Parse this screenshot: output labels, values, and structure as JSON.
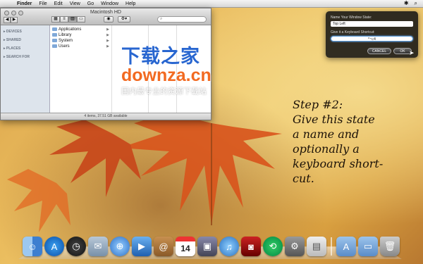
{
  "menubar": {
    "apple": "",
    "items": [
      "Finder",
      "File",
      "Edit",
      "View",
      "Go",
      "Window",
      "Help"
    ],
    "right_icons": [
      "bluetooth-star-icon",
      "spotlight-icon"
    ]
  },
  "finder": {
    "title": "Macintosh HD",
    "search_placeholder": "",
    "sidebar_sections": [
      "DEVICES",
      "SHARED",
      "PLACES",
      "SEARCH FOR"
    ],
    "column_items": [
      "Applications",
      "Library",
      "System",
      "Users"
    ],
    "status": "4 items, 37.51 GB available"
  },
  "dialog": {
    "name_label": "Name Your Window State:",
    "name_value": "Top Left",
    "shortcut_label": "Give it a Keyboard Shortcut:",
    "shortcut_value": "^⌥4",
    "cancel": "CANCEL",
    "ok": "OK"
  },
  "watermark": {
    "cn": "下载之家",
    "en": "downza.cn",
    "sub": "国内最专业的资源下载站"
  },
  "step_text": [
    "Step #2:",
    "Give this state",
    "a name and",
    "optionally a",
    "keyboard short-",
    "cut."
  ],
  "dock": {
    "icons": [
      "finder-icon",
      "app-store-icon",
      "dashboard-icon",
      "mail-icon",
      "safari-icon",
      "facetime-icon",
      "address-book-icon",
      "ical-icon",
      "iphoto-icon",
      "itunes-icon",
      "photo-booth-icon",
      "time-machine-icon",
      "system-preferences-icon",
      "preview-icon",
      "applications-folder-icon",
      "documents-folder-icon",
      "trash-icon"
    ],
    "ical_day": "14"
  },
  "colors": {
    "watermark_blue": "#2866d0",
    "watermark_orange": "#f26a21",
    "dialog_bg": "#141414"
  }
}
